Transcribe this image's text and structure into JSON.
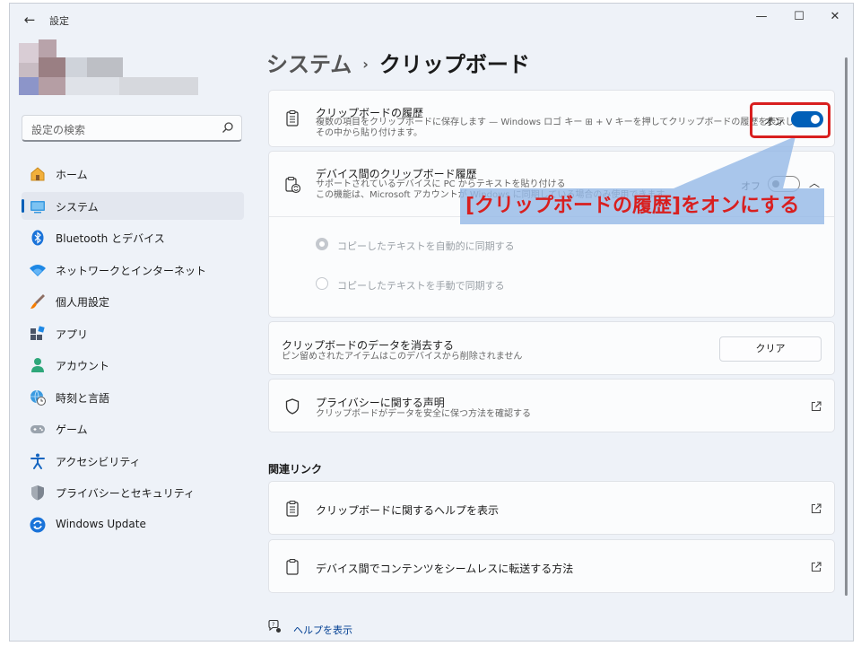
{
  "window": {
    "title": "設定",
    "back_icon": "←",
    "minimize_icon": "—",
    "maximize_icon": "☐",
    "close_icon": "✕"
  },
  "search": {
    "placeholder": "設定の検索"
  },
  "sidebar": {
    "items": [
      {
        "label": "ホーム",
        "icon": "home-icon",
        "active": false
      },
      {
        "label": "システム",
        "icon": "system-icon",
        "active": true
      },
      {
        "label": "Bluetooth とデバイス",
        "icon": "bluetooth-icon",
        "active": false
      },
      {
        "label": "ネットワークとインターネット",
        "icon": "wifi-icon",
        "active": false
      },
      {
        "label": "個人用設定",
        "icon": "brush-icon",
        "active": false
      },
      {
        "label": "アプリ",
        "icon": "apps-icon",
        "active": false
      },
      {
        "label": "アカウント",
        "icon": "account-icon",
        "active": false
      },
      {
        "label": "時刻と言語",
        "icon": "globe-clock-icon",
        "active": false
      },
      {
        "label": "ゲーム",
        "icon": "gamepad-icon",
        "active": false
      },
      {
        "label": "アクセシビリティ",
        "icon": "accessibility-icon",
        "active": false
      },
      {
        "label": "プライバシーとセキュリティ",
        "icon": "shield-icon",
        "active": false
      },
      {
        "label": "Windows Update",
        "icon": "update-icon",
        "active": false
      }
    ]
  },
  "breadcrumb": {
    "parent": "システム",
    "separator": "›",
    "current": "クリップボード"
  },
  "cards": {
    "history": {
      "title": "クリップボードの履歴",
      "desc_line1": "複数の項目をクリップボードに保存します — Windows ロゴ キー ⊞ + V キーを押してクリップボードの履歴を表示し、",
      "desc_line2": "その中から貼り付けます。",
      "toggle_label": "オン",
      "toggle_on": true
    },
    "sync": {
      "title": "デバイス間のクリップボード履歴",
      "desc_line1": "サポートされているデバイスに PC からテキストを貼り付ける",
      "desc_line2": "この機能は、Microsoft アカウントが Windows に同期している場合のみ使用できます",
      "toggle_label": "オフ",
      "toggle_on": false,
      "chevron": "︿",
      "options": [
        {
          "label": "コピーしたテキストを自動的に同期する",
          "checked": true
        },
        {
          "label": "コピーしたテキストを手動で同期する",
          "checked": false
        }
      ]
    },
    "clear": {
      "title": "クリップボードのデータを消去する",
      "desc": "ピン留めされたアイテムはこのデバイスから削除されません",
      "button": "クリア"
    },
    "privacy": {
      "title": "プライバシーに関する声明",
      "desc": "クリップボードがデータを安全に保つ方法を確認する"
    }
  },
  "related": {
    "heading": "関連リンク",
    "links": [
      {
        "label": "クリップボードに関するヘルプを表示"
      },
      {
        "label": "デバイス間でコンテンツをシームレスに転送する方法"
      }
    ]
  },
  "help": {
    "label": "ヘルプを表示"
  },
  "annotation": {
    "text": "[クリップボードの履歴]をオンにする",
    "color": "#d81f1f"
  },
  "colors": {
    "accent": "#005fb8",
    "background": "#eef2f8",
    "card": "#fbfcfd"
  }
}
